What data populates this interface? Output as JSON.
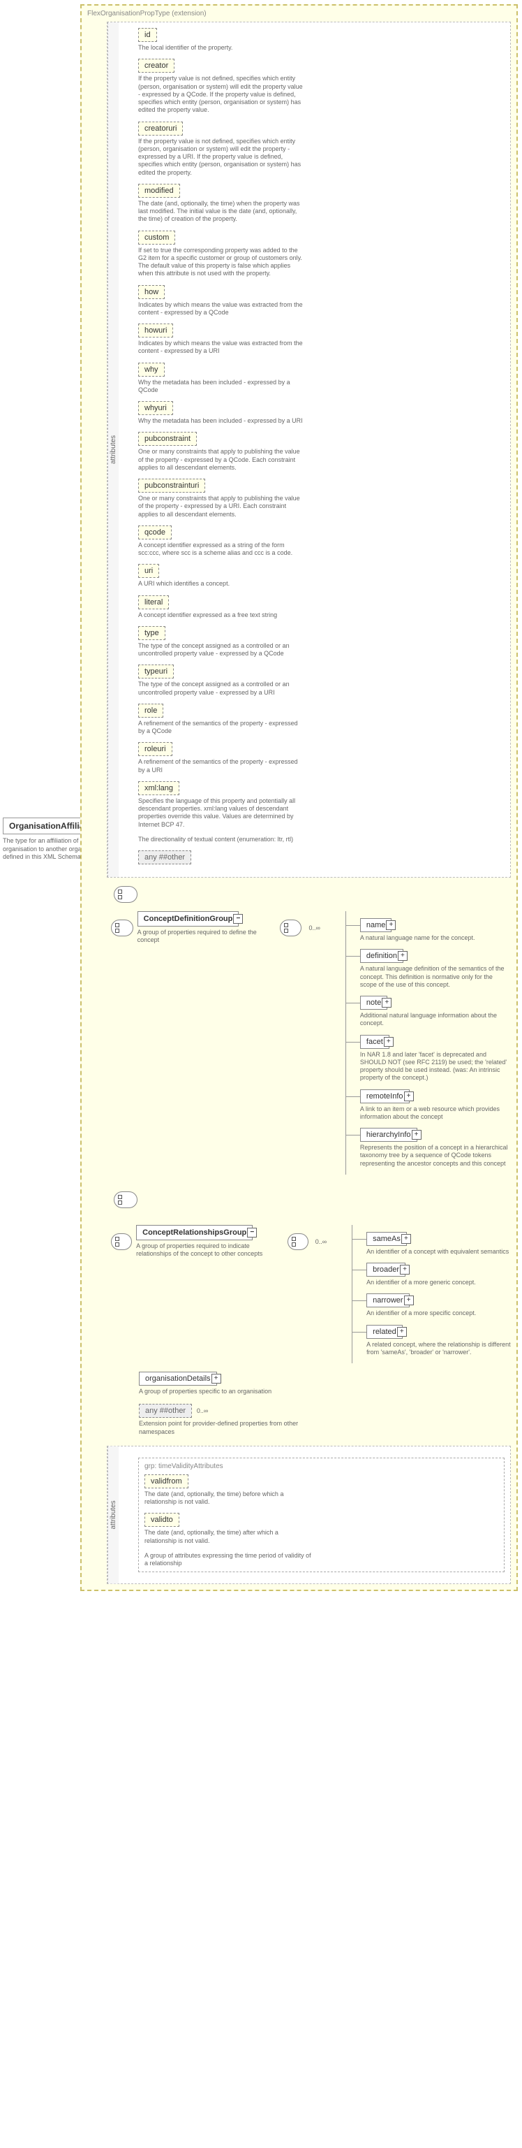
{
  "root": {
    "name": "OrganisationAffiliationType",
    "desc": "The type for an affiliation of an organisation to another organisation (Type defined in this XML Schema only)"
  },
  "extension": {
    "title": "FlexOrganisationPropType (extension)",
    "attrs_title": "attributes",
    "attributes": [
      {
        "name": "id",
        "desc": "The local identifier of the property."
      },
      {
        "name": "creator",
        "desc": "If the property value is not defined, specifies which entity (person, organisation or system) will edit the property value - expressed by a QCode. If the property value is defined, specifies which entity (person, organisation or system) has edited the property value."
      },
      {
        "name": "creatoruri",
        "desc": "If the property value is not defined, specifies which entity (person, organisation or system) will edit the property - expressed by a URI. If the property value is defined, specifies which entity (person, organisation or system) has edited the property."
      },
      {
        "name": "modified",
        "desc": "The date (and, optionally, the time) when the property was last modified. The initial value is the date (and, optionally, the time) of creation of the property."
      },
      {
        "name": "custom",
        "desc": "If set to true the corresponding property was added to the G2 item for a specific customer or group of customers only. The default value of this property is false which applies when this attribute is not used with the property."
      },
      {
        "name": "how",
        "desc": "Indicates by which means the value was extracted from the content - expressed by a QCode"
      },
      {
        "name": "howuri",
        "desc": "Indicates by which means the value was extracted from the content - expressed by a URI"
      },
      {
        "name": "why",
        "desc": "Why the metadata has been included - expressed by a QCode"
      },
      {
        "name": "whyuri",
        "desc": "Why the metadata has been included - expressed by a URI"
      },
      {
        "name": "pubconstraint",
        "desc": "One or many constraints that apply to publishing the value of the property - expressed by a QCode. Each constraint applies to all descendant elements."
      },
      {
        "name": "pubconstrainturi",
        "desc": "One or many constraints that apply to publishing the value of the property - expressed by a URI. Each constraint applies to all descendant elements."
      },
      {
        "name": "qcode",
        "desc": "A concept identifier expressed as a string of the form scc:ccc, where scc is a scheme alias and ccc is a code."
      },
      {
        "name": "uri",
        "desc": "A URI which identifies a concept."
      },
      {
        "name": "literal",
        "desc": "A concept identifier expressed as a free text string"
      },
      {
        "name": "type",
        "desc": "The type of the concept assigned as a controlled or an uncontrolled property value - expressed by a QCode"
      },
      {
        "name": "typeuri",
        "desc": "The type of the concept assigned as a controlled or an uncontrolled property value - expressed by a URI"
      },
      {
        "name": "role",
        "desc": "A refinement of the semantics of the property - expressed by a QCode"
      },
      {
        "name": "roleuri",
        "desc": "A refinement of the semantics of the property - expressed by a URI"
      },
      {
        "name": "xml:lang",
        "desc": "Specifies the language of this property and potentially all descendant properties. xml:lang values of descendant properties override this value. Values are determined by Internet BCP 47."
      }
    ],
    "dir_desc": "The directionality of textual content (enumeration: ltr, rtl)",
    "any_other": "any ##other"
  },
  "concept_def": {
    "name": "ConceptDefinitionGroup",
    "desc": "A group of properties required to define the concept",
    "occ": "0..∞",
    "children": [
      {
        "name": "name",
        "desc": "A natural language name for the concept."
      },
      {
        "name": "definition",
        "desc": "A natural language definition of the semantics of the concept. This definition is normative only for the scope of the use of this concept."
      },
      {
        "name": "note",
        "desc": "Additional natural language information about the concept."
      },
      {
        "name": "facet",
        "desc": "In NAR 1.8 and later 'facet' is deprecated and SHOULD NOT (see RFC 2119) be used; the 'related' property should be used instead. (was: An intrinsic property of the concept.)"
      },
      {
        "name": "remoteInfo",
        "desc": "A link to an item or a web resource which provides information about the concept"
      },
      {
        "name": "hierarchyInfo",
        "desc": "Represents the position of a concept in a hierarchical taxonomy tree by a sequence of QCode tokens representing the ancestor concepts and this concept"
      }
    ]
  },
  "concept_rel": {
    "name": "ConceptRelationshipsGroup",
    "desc": "A group of properties required to indicate relationships of the concept to other concepts",
    "occ": "0..∞",
    "children": [
      {
        "name": "sameAs",
        "desc": "An identifier of a concept with equivalent semantics"
      },
      {
        "name": "broader",
        "desc": "An identifier of a more generic concept."
      },
      {
        "name": "narrower",
        "desc": "An identifier of a more specific concept."
      },
      {
        "name": "related",
        "desc": "A related concept, where the relationship is different from 'sameAs', 'broader' or 'narrower'."
      }
    ]
  },
  "org_details": {
    "name": "organisationDetails",
    "desc": "A group of properties specific to an organisation"
  },
  "any_other_row": {
    "name": "any ##other",
    "desc": "Extension point for provider-defined properties from other namespaces",
    "occ": "0..∞"
  },
  "time_validity": {
    "group_title": "grp: timeValidityAttributes",
    "attrs_title": "attributes",
    "validfrom": {
      "name": "validfrom",
      "desc": "The date (and, optionally, the time) before which a relationship is not valid."
    },
    "validto": {
      "name": "validto",
      "desc": "The date (and, optionally, the time) after which a relationship is not valid."
    },
    "footer": "A group of attributes expressing the time period of validity of a relationship"
  }
}
